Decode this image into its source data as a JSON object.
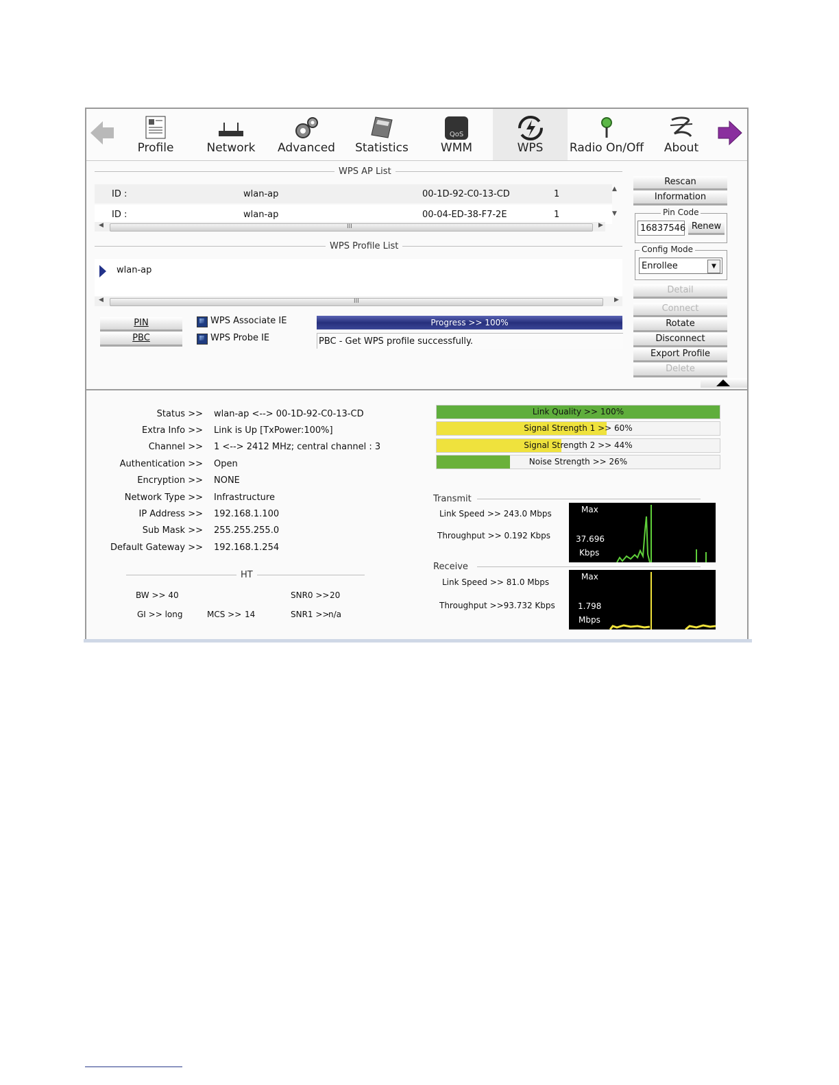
{
  "toolbar": {
    "items": [
      {
        "label": "Profile",
        "icon": "profile-document-icon"
      },
      {
        "label": "Network",
        "icon": "router-icon"
      },
      {
        "label": "Advanced",
        "icon": "gears-icon"
      },
      {
        "label": "Statistics",
        "icon": "calculator-icon"
      },
      {
        "label": "WMM",
        "icon": "qos-icon"
      },
      {
        "label": "WPS",
        "icon": "wps-icon",
        "active": true
      },
      {
        "label": "Radio On/Off",
        "icon": "antenna-icon"
      },
      {
        "label": "About",
        "icon": "about-logo-icon"
      }
    ]
  },
  "wps_ap_list": {
    "title": "WPS AP List",
    "rows": [
      {
        "id_label": "ID :",
        "ssid": "wlan-ap",
        "bssid": "00-1D-92-C0-13-CD",
        "channel": "1"
      },
      {
        "id_label": "ID :",
        "ssid": "wlan-ap",
        "bssid": "00-04-ED-38-F7-2E",
        "channel": "1"
      }
    ],
    "scroll_grip": "III"
  },
  "wps_profile_list": {
    "title": "WPS Profile List",
    "items": [
      "wlan-ap"
    ],
    "scroll_grip": "III"
  },
  "actions": {
    "pin": "PIN",
    "pbc": "PBC",
    "wps_associate_ie": "WPS Associate IE",
    "wps_probe_ie": "WPS Probe IE",
    "progress_text": "Progress >> 100%",
    "progress_value": 100,
    "message": "PBC - Get WPS profile successfully."
  },
  "side_panel": {
    "rescan": "Rescan",
    "information": "Information",
    "pin_code_legend": "Pin Code",
    "pin_code_value": "16837546",
    "renew": "Renew",
    "config_mode_legend": "Config Mode",
    "config_mode_value": "Enrollee",
    "detail": "Detail",
    "connect": "Connect",
    "rotate": "Rotate",
    "disconnect": "Disconnect",
    "export_profile": "Export Profile",
    "delete": "Delete"
  },
  "status": {
    "labels": [
      "Status >>",
      "Extra Info >>",
      "Channel >>",
      "Authentication >>",
      "Encryption >>",
      "Network Type >>",
      "IP Address >>",
      "Sub Mask >>",
      "Default Gateway >>"
    ],
    "values": [
      "wlan-ap <--> 00-1D-92-C0-13-CD",
      "Link is Up [TxPower:100%]",
      "1 <--> 2412 MHz; central channel : 3",
      "Open",
      "NONE",
      "Infrastructure",
      "192.168.1.100",
      "255.255.255.0",
      "192.168.1.254"
    ]
  },
  "ht": {
    "title": "HT",
    "bw": "BW >> 40",
    "gi": "GI >> long",
    "mcs_label": "MCS >>",
    "mcs_value": "14",
    "snr0_label": "SNR0 >>",
    "snr0_value": "20",
    "snr1_label": "SNR1 >>",
    "snr1_value": "n/a"
  },
  "signal": {
    "bars": [
      {
        "text": "Link Quality >> 100%",
        "value": 100,
        "color": "#5fae3c"
      },
      {
        "text": "Signal Strength 1 >> 60%",
        "value": 60,
        "color": "#efe23d"
      },
      {
        "text": "Signal Strength 2 >> 44%",
        "value": 44,
        "color": "#efe23d"
      },
      {
        "text": "Noise Strength >> 26%",
        "value": 26,
        "color": "#6ab13a"
      }
    ]
  },
  "transmit": {
    "title": "Transmit",
    "link_speed": "Link Speed >>  243.0 Mbps",
    "throughput": "Throughput >> 0.192 Kbps",
    "graph_max": "Max",
    "graph_value": "37.696",
    "graph_unit": "Kbps"
  },
  "receive": {
    "title": "Receive",
    "link_speed": "Link Speed >> 81.0 Mbps",
    "throughput": "Throughput >>93.732 Kbps",
    "graph_max": "Max",
    "graph_value": "1.798",
    "graph_unit": "Mbps"
  }
}
